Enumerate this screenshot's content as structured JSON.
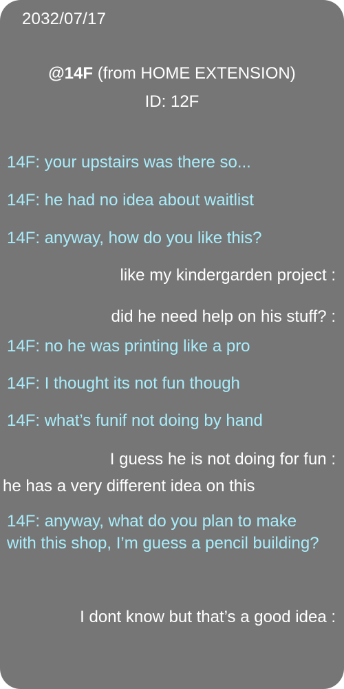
{
  "status": {
    "date": "2032/07/17"
  },
  "header": {
    "handle": "@14F",
    "origin": " (from HOME EXTENSION)",
    "id_line": "ID: 12F"
  },
  "colors": {
    "background": "#767676",
    "incoming_text": "#a9eefc",
    "outgoing_text": "#ffffff"
  },
  "messages": [
    {
      "sender": "14F",
      "text": "14F: your upstairs was there so..."
    },
    {
      "sender": "14F",
      "text": "14F: he had no idea about waitlist"
    },
    {
      "sender": "14F",
      "text": "14F: anyway, how do you like this?"
    },
    {
      "sender": "me",
      "text": "like my kindergarden project  :"
    },
    {
      "sender": "me",
      "text": "did he need help on his stuff?  :"
    },
    {
      "sender": "14F",
      "text": "14F: no he was printing like a pro"
    },
    {
      "sender": "14F",
      "text": "14F: I thought its not fun though"
    },
    {
      "sender": "14F",
      "text": "14F: what’s funif not doing by hand"
    },
    {
      "sender": "me",
      "text": "I guess he is not doing for fun :"
    },
    {
      "sender": "me",
      "text": "he has a very different idea on this"
    },
    {
      "sender": "14F",
      "text": "14F: anyway, what do you plan to make with this shop, I’m guess a pencil building?"
    },
    {
      "sender": "me",
      "text": "I dont know but that’s a good idea :"
    }
  ]
}
